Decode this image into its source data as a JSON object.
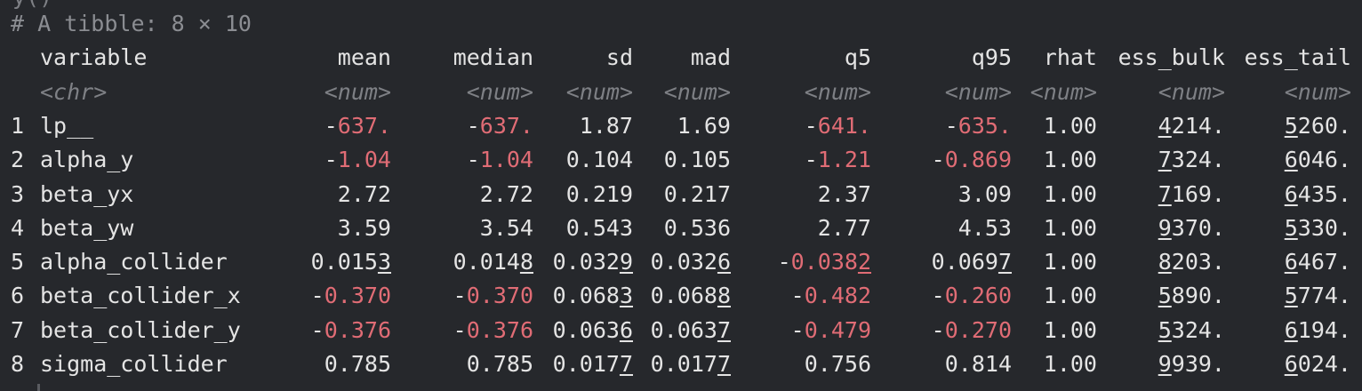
{
  "console": {
    "prev_command_tail": "y()",
    "tibble_header": "# A tibble: 8 × 10",
    "columns": [
      "variable",
      "mean",
      "median",
      "sd",
      "mad",
      "q5",
      "q95",
      "rhat",
      "ess_bulk",
      "ess_tail"
    ],
    "column_types": [
      "<chr>",
      "<num>",
      "<num>",
      "<num>",
      "<num>",
      "<num>",
      "<num>",
      "<num>",
      "<num>",
      "<num>"
    ],
    "rows": [
      {
        "idx": "1",
        "variable": "lp__",
        "mean": "-637.",
        "median": "-637.",
        "sd": "1.87",
        "mad": "1.69",
        "q5": "-641.",
        "q95": "-635.",
        "rhat": "1.00",
        "ess_bulk": "4214.",
        "ess_tail": "5260."
      },
      {
        "idx": "2",
        "variable": "alpha_y",
        "mean": "-1.04",
        "median": "-1.04",
        "sd": "0.104",
        "mad": "0.105",
        "q5": "-1.21",
        "q95": "-0.869",
        "rhat": "1.00",
        "ess_bulk": "7324.",
        "ess_tail": "6046."
      },
      {
        "idx": "3",
        "variable": "beta_yx",
        "mean": "2.72",
        "median": "2.72",
        "sd": "0.219",
        "mad": "0.217",
        "q5": "2.37",
        "q95": "3.09",
        "rhat": "1.00",
        "ess_bulk": "7169.",
        "ess_tail": "6435."
      },
      {
        "idx": "4",
        "variable": "beta_yw",
        "mean": "3.59",
        "median": "3.54",
        "sd": "0.543",
        "mad": "0.536",
        "q5": "2.77",
        "q95": "4.53",
        "rhat": "1.00",
        "ess_bulk": "9370.",
        "ess_tail": "5330."
      },
      {
        "idx": "5",
        "variable": "alpha_collider",
        "mean": "0.0153",
        "median": "0.0148",
        "sd": "0.0329",
        "mad": "0.0326",
        "q5": "-0.0382",
        "q95": "0.0697",
        "rhat": "1.00",
        "ess_bulk": "8203.",
        "ess_tail": "6467."
      },
      {
        "idx": "6",
        "variable": "beta_collider_x",
        "mean": "-0.370",
        "median": "-0.370",
        "sd": "0.0683",
        "mad": "0.0688",
        "q5": "-0.482",
        "q95": "-0.260",
        "rhat": "1.00",
        "ess_bulk": "5890.",
        "ess_tail": "5774."
      },
      {
        "idx": "7",
        "variable": "beta_collider_y",
        "mean": "-0.376",
        "median": "-0.376",
        "sd": "0.0636",
        "mad": "0.0637",
        "q5": "-0.479",
        "q95": "-0.270",
        "rhat": "1.00",
        "ess_bulk": "5324.",
        "ess_tail": "6194."
      },
      {
        "idx": "8",
        "variable": "sigma_collider",
        "mean": "0.785",
        "median": "0.785",
        "sd": "0.0177",
        "mad": "0.0177",
        "q5": "0.756",
        "q95": "0.814",
        "rhat": "1.00",
        "ess_bulk": "9939.",
        "ess_tail": "6024."
      }
    ]
  },
  "colors": {
    "background": "#26282c",
    "text": "#e4e4e4",
    "dim_text": "#8b8d92",
    "negative": "#e06c75"
  }
}
